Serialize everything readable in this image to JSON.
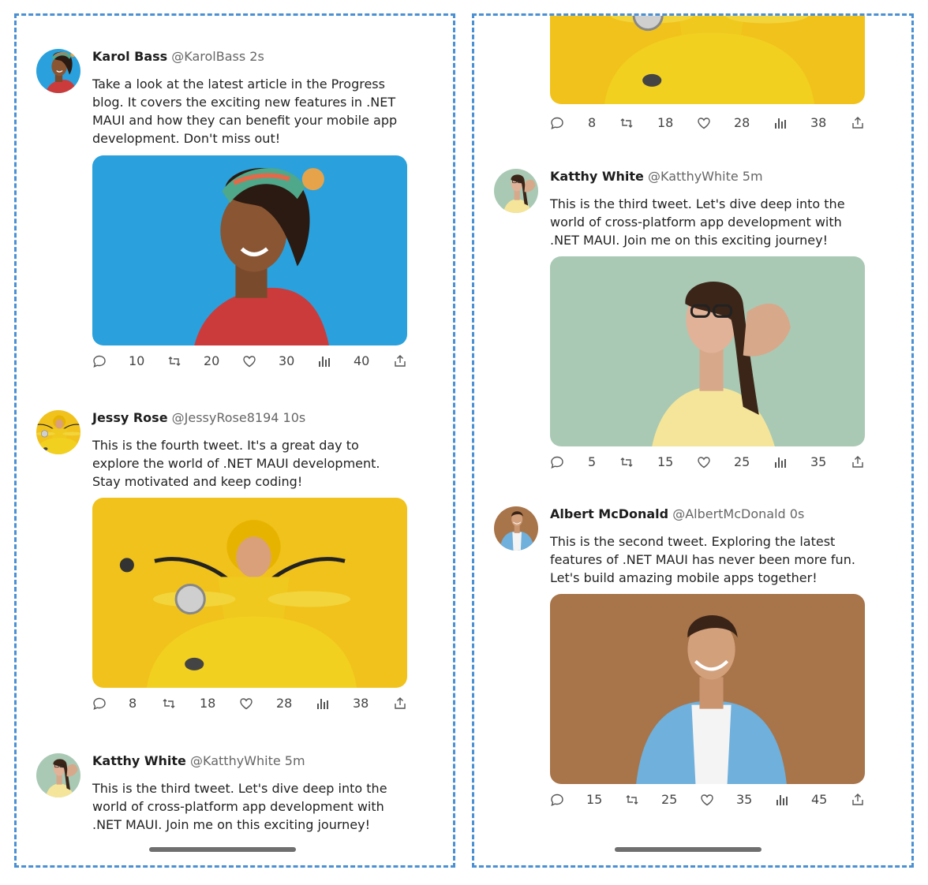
{
  "icons": [
    "reply-icon",
    "retweet-icon",
    "like-icon",
    "views-icon",
    "share-icon"
  ],
  "colors": {
    "panel_border": "#4a90d2",
    "karol_bg": "#2aa1dc",
    "jessy_bg": "#f1c21b",
    "kathy_bg": "#a9c9b4",
    "albert_bg": "#a87449"
  },
  "left": {
    "tweets": [
      {
        "name": "Karol Bass",
        "handle": "@KarolBass 2s",
        "text": "Take a look at the latest article in the Progress blog. It covers the exciting new features in .NET MAUI and how they can benefit your mobile app development. Don't miss out!",
        "replies": "10",
        "retweets": "20",
        "likes": "30",
        "views": "40"
      },
      {
        "name": "Jessy Rose",
        "handle": "@JessyRose8194 10s",
        "text": "This is the fourth tweet. It's a great day to explore the world of .NET MAUI development. Stay motivated and keep coding!",
        "replies": "8",
        "retweets": "18",
        "likes": "28",
        "views": "38"
      },
      {
        "name": "Katthy White",
        "handle": "@KatthyWhite 5m",
        "text": "This is the third tweet. Let's dive deep into the world of cross-platform app development with .NET MAUI. Join me on this exciting journey!"
      }
    ]
  },
  "right": {
    "top_actions": {
      "replies": "8",
      "retweets": "18",
      "likes": "28",
      "views": "38"
    },
    "tweets": [
      {
        "name": "Katthy White",
        "handle": "@KatthyWhite 5m",
        "text": "This is the third tweet. Let's dive deep into the world of cross-platform app development with .NET MAUI. Join me on this exciting journey!",
        "replies": "5",
        "retweets": "15",
        "likes": "25",
        "views": "35"
      },
      {
        "name": "Albert McDonald",
        "handle": "@AlbertMcDonald 0s",
        "text": "This is the second tweet. Exploring the latest features of .NET MAUI has never been more fun. Let's build amazing mobile apps together!",
        "replies": "15",
        "retweets": "25",
        "likes": "35",
        "views": "45"
      }
    ]
  }
}
